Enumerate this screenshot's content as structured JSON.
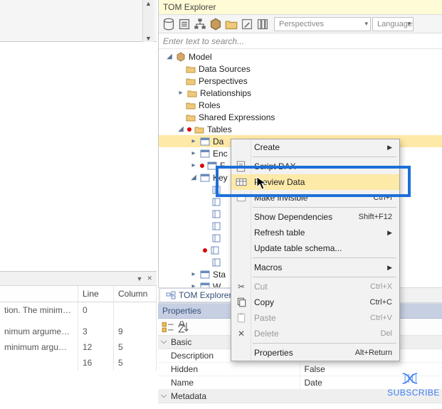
{
  "tom": {
    "title": "TOM Explorer",
    "perspectives": "Perspectives",
    "languages": "Languages",
    "search_placeholder": "Enter text to search..."
  },
  "tree": {
    "model": "Model",
    "data_sources": "Data Sources",
    "perspectives": "Perspectives",
    "relationships": "Relationships",
    "roles": "Roles",
    "shared": "Shared Expressions",
    "tables": "Tables",
    "t_da": "Da",
    "t_enc": "Enc",
    "t_f": "F",
    "t_key": "Key",
    "t_sta": "Sta",
    "t_w": "W"
  },
  "ctx": {
    "create": "Create",
    "script_dax": "Script DAX",
    "preview": "Preview Data",
    "make_invisible": "Make invisible",
    "make_invisible_short": "Ctrl+I",
    "show_deps": "Show Dependencies",
    "show_deps_short": "Shift+F12",
    "refresh": "Refresh table",
    "update_schema": "Update table schema...",
    "macros": "Macros",
    "cut": "Cut",
    "cut_short": "Ctrl+X",
    "copy": "Copy",
    "copy_short": "Ctrl+C",
    "paste": "Paste",
    "paste_short": "Ctrl+V",
    "delete": "Delete",
    "delete_short": "Del",
    "properties": "Properties",
    "properties_short": "Alt+Return"
  },
  "left_table": {
    "col1": "",
    "col_line": "Line",
    "col_column": "Column",
    "rows": [
      {
        "msg": "tion. The minimum...",
        "line": "0",
        "col": ""
      },
      {
        "msg": "",
        "line": "",
        "col": ""
      },
      {
        "msg": "nimum argument c...",
        "line": "3",
        "col": "9"
      },
      {
        "msg": "minimum argument ...",
        "line": "12",
        "col": "5"
      },
      {
        "msg": "",
        "line": "16",
        "col": "5"
      }
    ]
  },
  "tab": {
    "tom_explorer": "TOM Explorer"
  },
  "props": {
    "title": "Properties",
    "cat_basic": "Basic",
    "cat_metadata": "Metadata",
    "desc_k": "Description",
    "desc_v": "",
    "hidden_k": "Hidden",
    "hidden_v": "False",
    "name_k": "Name",
    "name_v": "Date"
  },
  "subscribe": "SUBSCRIBE"
}
